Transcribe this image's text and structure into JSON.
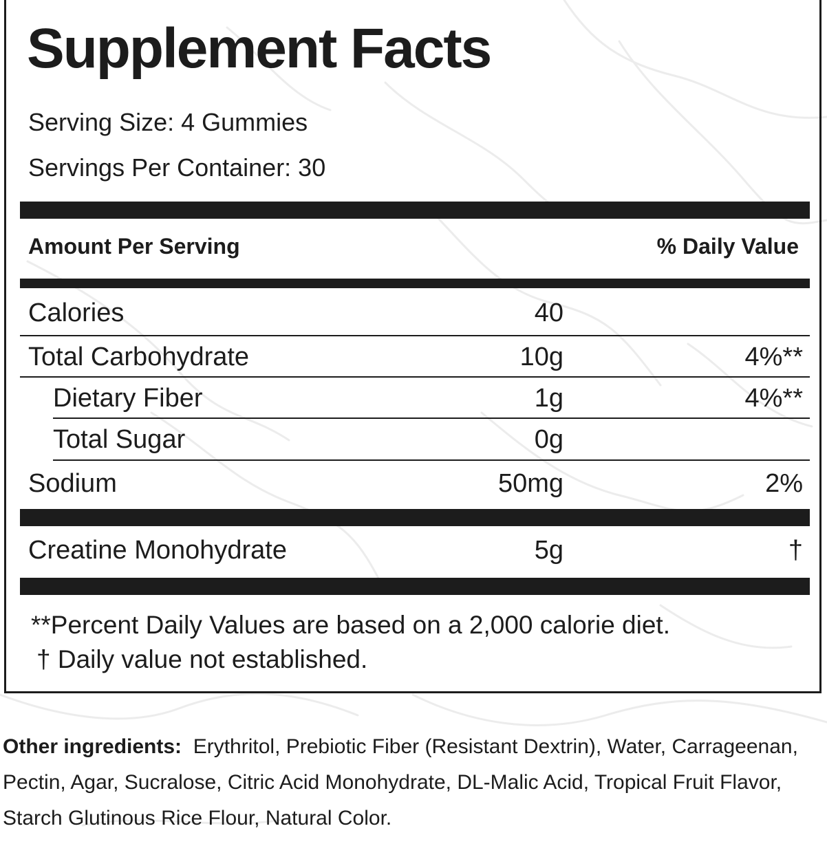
{
  "title": "Supplement Facts",
  "serving_size": "Serving Size: 4 Gummies",
  "servings_per_container": "Servings Per Container: 30",
  "header": {
    "amount_per_serving": "Amount Per Serving",
    "daily_value": "% Daily Value"
  },
  "rows": [
    {
      "name": "Calories",
      "amount": "40",
      "dv": ""
    },
    {
      "name": "Total Carbohydrate",
      "amount": "10g",
      "dv": "4%**"
    },
    {
      "name": "Dietary Fiber",
      "amount": "1g",
      "dv": "4%**"
    },
    {
      "name": "Total Sugar",
      "amount": "0g",
      "dv": ""
    },
    {
      "name": "Sodium",
      "amount": "50mg",
      "dv": "2%"
    },
    {
      "name": "Creatine Monohydrate",
      "amount": "5g",
      "dv": "†"
    }
  ],
  "footnotes": {
    "percent_daily": "**Percent Daily Values are based on a 2,000 calorie diet.",
    "not_established": "†  Daily value not established."
  },
  "other_ingredients": {
    "label": "Other ingredients:",
    "text": "Erythritol, Prebiotic Fiber (Resistant Dextrin), Water, Carrageenan, Pectin, Agar, Sucralose, Citric Acid Monohydrate, DL-Malic Acid, Tropical Fruit Flavor, Starch Glutinous Rice Flour, Natural Color."
  },
  "colors": {
    "ink": "#1c1c1c",
    "background": "#ffffff",
    "texture": "#ececec"
  }
}
